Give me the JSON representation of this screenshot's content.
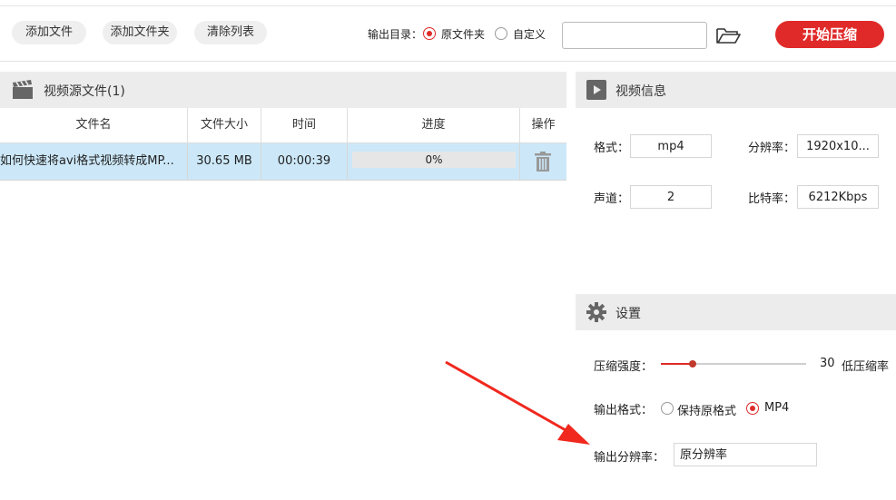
{
  "toolbar": {
    "add_file": "添加文件",
    "add_folder": "添加文件夹",
    "clear_list": "清除列表",
    "output_dir_label": "输出目录：",
    "opt_source_folder": "原文件夹",
    "opt_custom": "自定义",
    "path_value": "",
    "start": "开始压缩"
  },
  "source_panel": {
    "title": "视频源文件(1)",
    "columns": [
      "文件名",
      "文件大小",
      "时间",
      "进度",
      "操作"
    ],
    "rows": [
      {
        "name": "如何快速将avi格式视频转成MP...",
        "size": "30.65 MB",
        "time": "00:00:39",
        "progress_text": "0%",
        "progress": 0
      }
    ]
  },
  "info_panel": {
    "title": "视频信息",
    "format_label": "格式：",
    "format_value": "mp4",
    "resolution_label": "分辨率：",
    "resolution_value": "1920x10...",
    "channel_label": "声道：",
    "channel_value": "2",
    "bitrate_label": "比特率：",
    "bitrate_value": "6212Kbps"
  },
  "settings_panel": {
    "title": "设置",
    "strength_label": "压缩强度：",
    "strength_value": "30",
    "strength_fraction": 0.22,
    "strength_desc": "低压缩率",
    "format_label": "输出格式：",
    "opt_keep": "保持原格式",
    "opt_mp4": "MP4",
    "res_label": "输出分辨率：",
    "res_value": "原分辨率"
  },
  "colors": {
    "accent": "#e02a2a",
    "row_selected": "#cce8f8",
    "panel_header": "#ececec",
    "annotation_arrow": "#f0281e"
  }
}
